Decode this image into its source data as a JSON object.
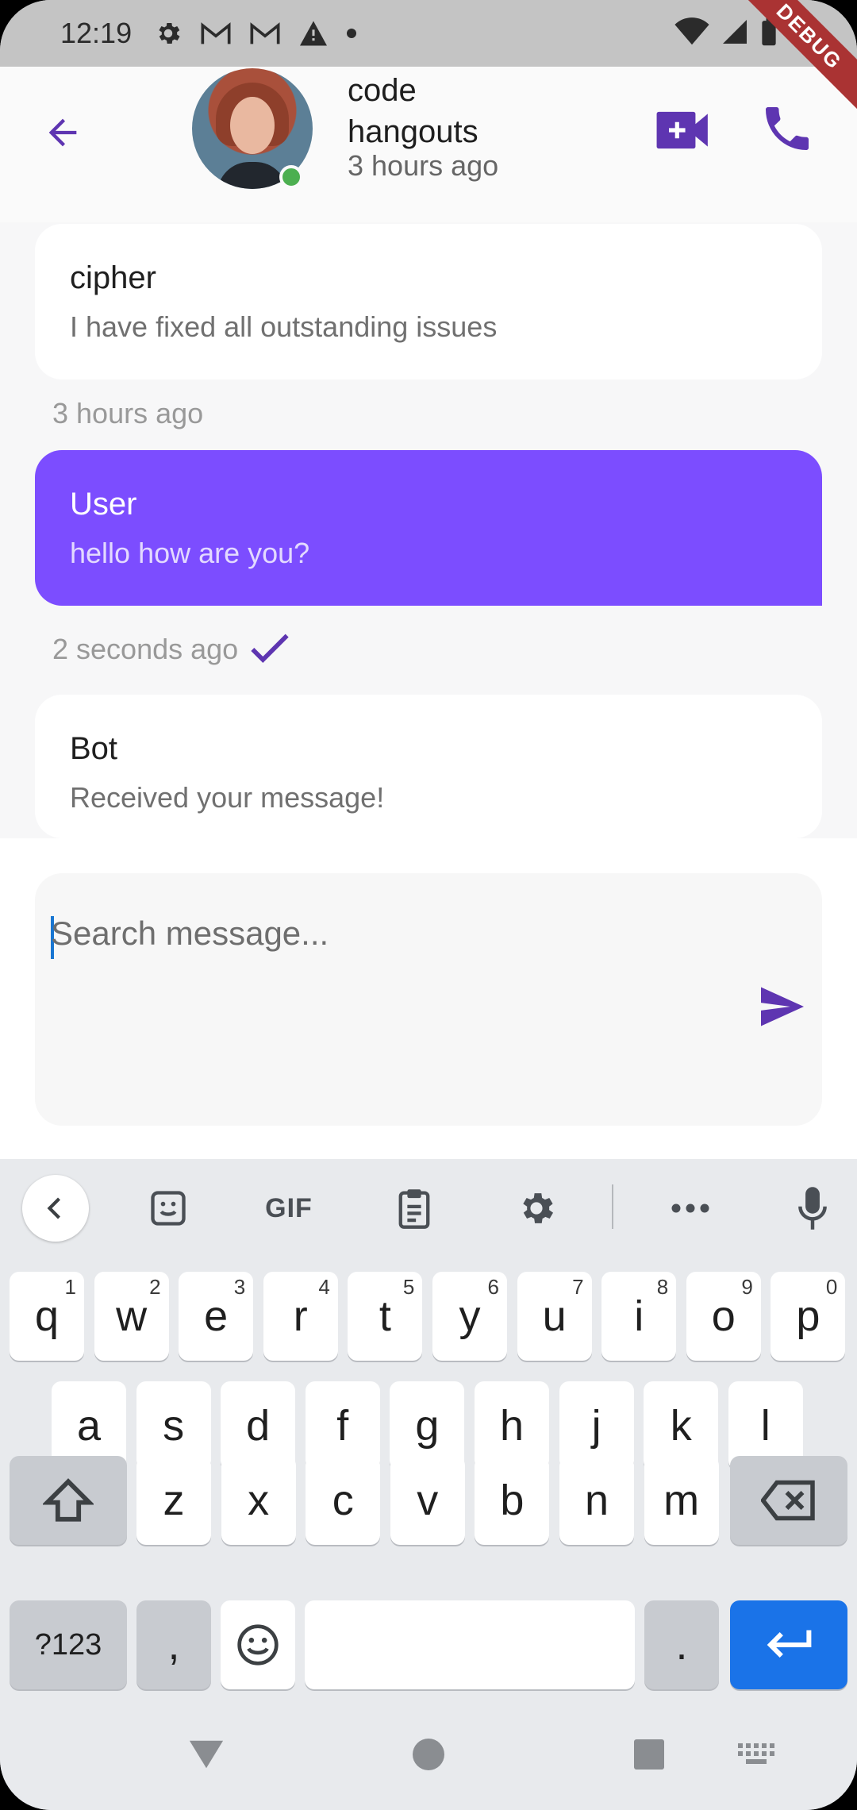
{
  "status_bar": {
    "time": "12:19",
    "icons": [
      "settings-icon",
      "gmail-icon",
      "gmail-icon",
      "warning-icon",
      "dot-icon",
      "wifi-icon",
      "signal-icon",
      "battery-icon"
    ]
  },
  "debug_banner": "DEBUG",
  "header": {
    "contact_name": "code hangouts",
    "status": "3 hours ago",
    "accent_color": "#5e35b1",
    "online_color": "#4caf50"
  },
  "messages": [
    {
      "sender": "cipher",
      "text": "I have fixed all outstanding issues",
      "time": "3 hours ago",
      "from_user": false
    },
    {
      "sender": "User",
      "text": "hello how are you?",
      "time": "2 seconds ago",
      "from_user": true,
      "delivered": true
    },
    {
      "sender": "Bot",
      "text": "Received your message!",
      "from_user": false
    }
  ],
  "composer": {
    "placeholder": "Search message...",
    "value": ""
  },
  "keyboard": {
    "toolbar": [
      "back-icon",
      "sticker-icon",
      "GIF",
      "clipboard-icon",
      "settings-icon",
      "more-icon",
      "mic-icon"
    ],
    "gif_label": "GIF",
    "row1": [
      {
        "k": "q",
        "s": "1"
      },
      {
        "k": "w",
        "s": "2"
      },
      {
        "k": "e",
        "s": "3"
      },
      {
        "k": "r",
        "s": "4"
      },
      {
        "k": "t",
        "s": "5"
      },
      {
        "k": "y",
        "s": "6"
      },
      {
        "k": "u",
        "s": "7"
      },
      {
        "k": "i",
        "s": "8"
      },
      {
        "k": "o",
        "s": "9"
      },
      {
        "k": "p",
        "s": "0"
      }
    ],
    "row2": [
      "a",
      "s",
      "d",
      "f",
      "g",
      "h",
      "j",
      "k",
      "l"
    ],
    "row3": [
      "z",
      "x",
      "c",
      "v",
      "b",
      "n",
      "m"
    ],
    "symbols_label": "?123",
    "comma_label": ",",
    "period_label": ".",
    "enter_color": "#1a73e8"
  },
  "user_bubble_color": "#7c4dff"
}
